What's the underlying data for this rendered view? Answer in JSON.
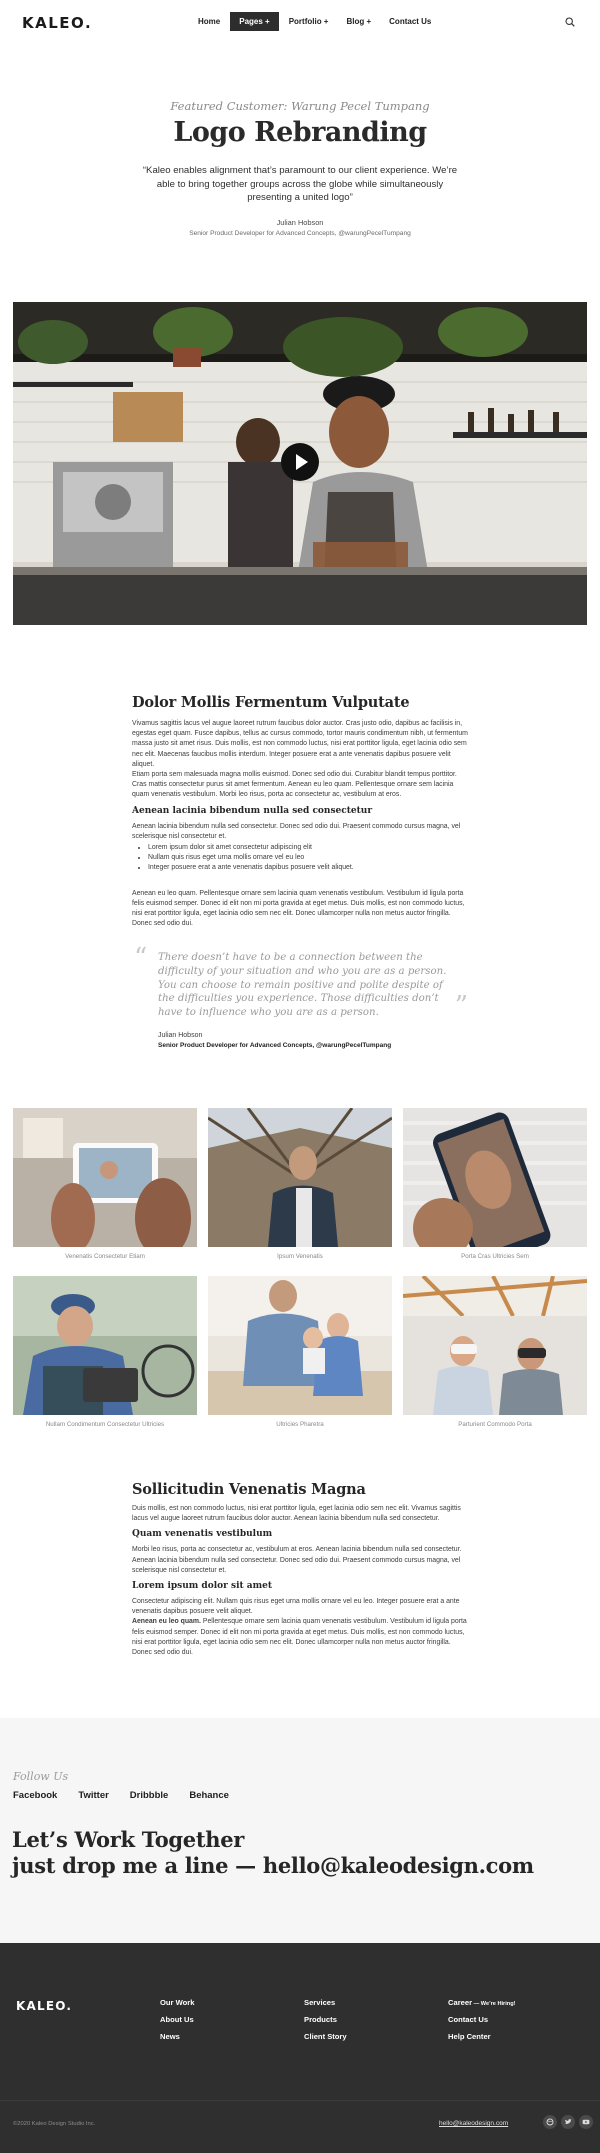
{
  "header": {
    "logo": "KALEO.",
    "nav": [
      "Home",
      "Pages +",
      "Portfolio +",
      "Blog +",
      "Contact Us"
    ],
    "active_nav": "Pages +"
  },
  "hero": {
    "featured": "Featured Customer: Warung Pecel Tumpang",
    "title": "Logo Rebranding",
    "quote": "“Kaleo enables alignment that’s paramount to our client experience. We’re able to bring together groups across the globe while simultaneously presenting a united logo”",
    "name": "Julian Hobson",
    "role": "Senior Product Developer for Advanced Concepts, @warungPecelTumpang"
  },
  "video": {
    "play_icon": "play-icon"
  },
  "article1": {
    "title": "Dolor Mollis Fermentum Vulputate",
    "p1": "Vivamus sagittis lacus vel augue laoreet rutrum faucibus dolor auctor. Cras justo odio, dapibus ac facilisis in, egestas eget quam. Fusce dapibus, tellus ac cursus commodo, tortor mauris condimentum nibh, ut fermentum massa justo sit amet risus. Duis mollis, est non commodo luctus, nisi erat porttitor ligula, eget lacinia odio sem nec elit. Maecenas faucibus mollis interdum. Integer posuere erat a ante venenatis dapibus posuere velit aliquet.",
    "p2": "Etiam porta sem malesuada magna mollis euismod. Donec sed odio dui. Curabitur blandit tempus porttitor. Cras mattis consectetur purus sit amet fermentum. Aenean eu leo quam. Pellentesque ornare sem lacinia quam venenatis vestibulum. Morbi leo risus, porta ac consectetur ac, vestibulum at eros.",
    "subtitle": "Aenean lacinia bibendum nulla sed consectetur",
    "p3": "Aenean lacinia bibendum nulla sed consectetur. Donec sed odio dui. Praesent commodo cursus magna, vel scelerisque nisl consectetur et.",
    "list": [
      "Lorem ipsum dolor sit amet consectetur adipiscing elit",
      "Nullam quis risus eget urna mollis ornare vel eu leo",
      "Integer posuere erat a ante venenatis dapibus posuere velit aliquet."
    ],
    "p4": "Aenean eu leo quam. Pellentesque ornare sem lacinia quam venenatis vestibulum. Vestibulum id ligula porta felis euismod semper. Donec id elit non mi porta gravida at eget metus. Duis mollis, est non commodo luctus, nisi erat porttitor ligula, eget lacinia odio sem nec elit. Donec ullamcorper nulla non metus auctor fringilla. Donec sed odio dui.",
    "quote": "There doesn’t have to be a connection between the difficulty of your situation and who you are as a person. You can choose to remain positive and polite despite of the difficulties you experience. Those difficulties don’t have to influence who you are as a person.",
    "quote_name": "Julian Hobson",
    "quote_role": "Senior Product Developer for Advanced Concepts, @warungPecelTumpang"
  },
  "gallery": [
    {
      "caption": "Venenatis Consectetur Etiam"
    },
    {
      "caption": "Ipsum Venenatis"
    },
    {
      "caption": "Porta Cras Ultricies Sem"
    },
    {
      "caption": "Nullam Condimentum Consectetur Ultricies"
    },
    {
      "caption": "Ultricies Pharetra"
    },
    {
      "caption": "Parturient Commodo Porta"
    }
  ],
  "article2": {
    "title": "Sollicitudin Venenatis Magna",
    "p1": "Duis mollis, est non commodo luctus, nisi erat porttitor ligula, eget lacinia odio sem nec elit. Vivamus sagittis lacus vel augue laoreet rutrum faucibus dolor auctor. Aenean lacinia bibendum nulla sed consectetur.",
    "subtitle1": "Quam venenatis vestibulum",
    "p2": "Morbi leo risus, porta ac consectetur ac, vestibulum at eros. Aenean lacinia bibendum nulla sed consectetur. Aenean lacinia bibendum nulla sed consectetur. Donec sed odio dui. Praesent commodo cursus magna, vel scelerisque nisl consectetur et.",
    "subtitle2": "Lorem ipsum dolor sit amet",
    "p3": "Consectetur adipiscing elit. Nullam quis risus eget urna mollis ornare vel eu leo. Integer posuere erat a ante venenatis dapibus posuere velit aliquet.",
    "p4_bold": "Aenean eu leo quam.",
    "p4": " Pellentesque ornare sem lacinia quam venenatis vestibulum. Vestibulum id ligula porta felis euismod semper. Donec id elit non mi porta gravida at eget metus. Duis mollis, est non commodo luctus, nisi erat porttitor ligula, eget lacinia odio sem nec elit. Donec ullamcorper nulla non metus auctor fringilla. Donec sed odio dui."
  },
  "cta": {
    "follow": "Follow Us",
    "social": [
      "Facebook",
      "Twitter",
      "Dribbble",
      "Behance"
    ],
    "line1": "Let’s Work Together",
    "line2": "just drop me a line —  hello@kaleodesign.com"
  },
  "footer": {
    "logo": "KALEO.",
    "col1": [
      "Our Work",
      "About Us",
      "News"
    ],
    "col2": [
      "Services",
      "Products",
      "Client Story"
    ],
    "col3_first": "Career",
    "col3_badge": " — We’re Hiring!",
    "col3": [
      "Contact Us",
      "Help Center"
    ],
    "copyright": "©2020 Kaleo Design Studio Inc.",
    "email": "hello@kaleodesign.com",
    "social_icons": [
      "dribbble-icon",
      "twitter-icon",
      "youtube-icon"
    ]
  },
  "colors": {
    "dark": "#2f2f30",
    "cta_bg": "#f6f6f7",
    "accent_text": "#262626"
  }
}
